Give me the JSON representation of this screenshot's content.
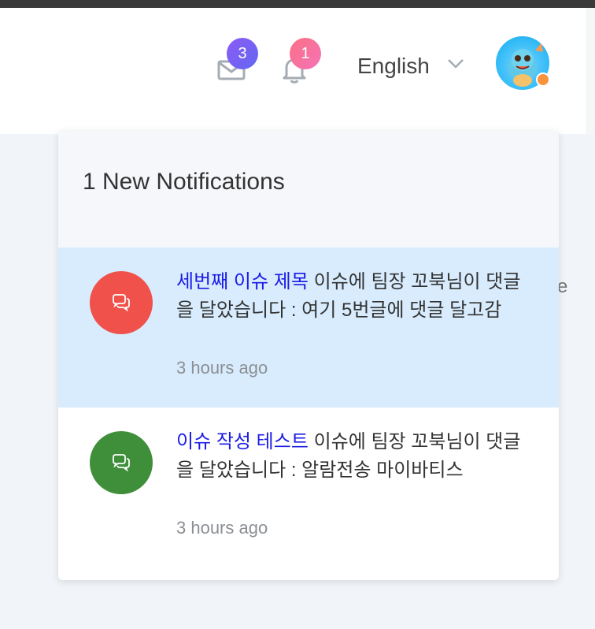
{
  "header": {
    "mail": {
      "icon": "mail-icon",
      "badge_count": "3"
    },
    "notifications": {
      "icon": "bell-icon",
      "badge_count": "1"
    },
    "language": {
      "selected": "English",
      "icon": "chevron-down-icon"
    },
    "avatar": {
      "icon": "user-avatar",
      "status_color": "#fb923c"
    }
  },
  "page_edge_text": "e",
  "dropdown": {
    "title": "1 New Notifications",
    "items": [
      {
        "link": "세번째 이슈 제목",
        "message": " 이슈에 팀장 꼬북님이 댓글을 달았습니다 : 여기 5번글에 댓글 달고감",
        "time": "3 hours ago",
        "icon": "comments-icon",
        "icon_color": "#f0514a",
        "unread": true
      },
      {
        "link": "이슈 작성 테스트",
        "message": " 이슈에 팀장 꼬북님이 댓글을 달았습니다 : 알람전송 마이바티스",
        "time": "3 hours ago",
        "icon": "comments-icon",
        "icon_color": "#3f8f3a",
        "unread": false
      }
    ]
  },
  "colors": {
    "mail_badge": "#7c5cf0",
    "bell_badge": "#f87187",
    "active_row": "#d8ecfd",
    "link": "#1b1be6"
  }
}
